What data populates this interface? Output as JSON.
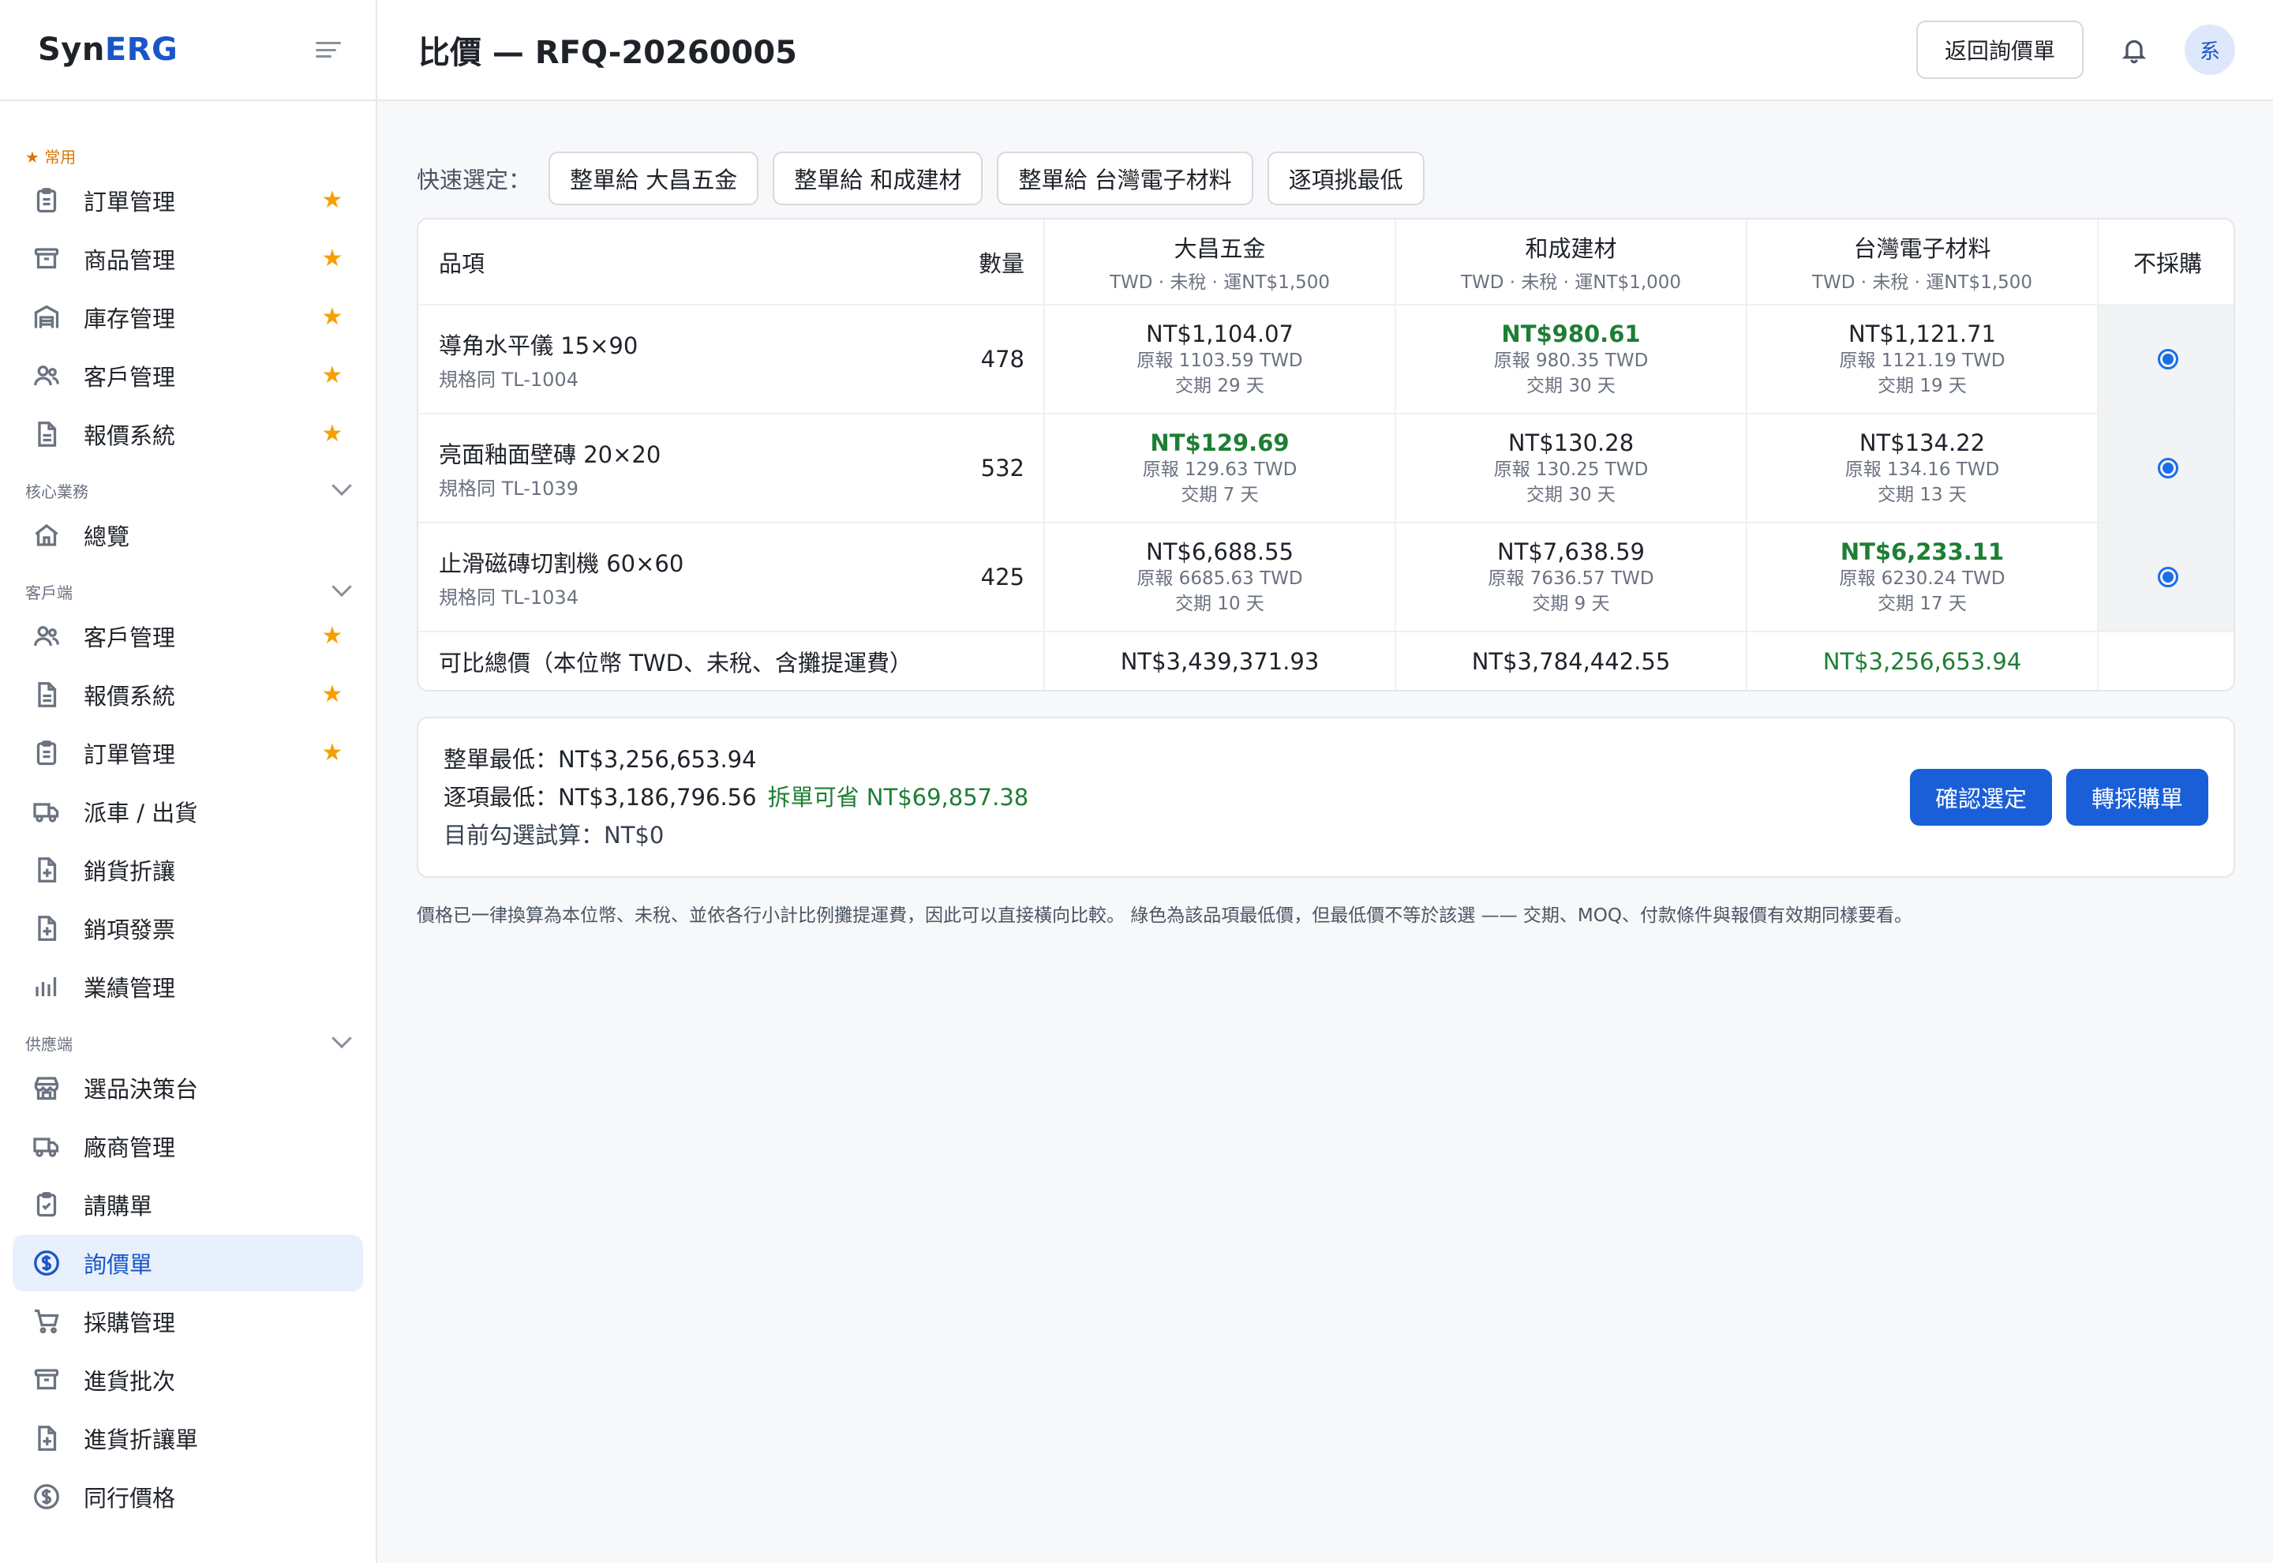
{
  "brand": {
    "syn": "Syn",
    "erg": "ERG"
  },
  "sidebar": {
    "favorites_label": "★ 常用",
    "favorites": [
      {
        "label": "訂單管理",
        "icon": "clipboard-icon"
      },
      {
        "label": "商品管理",
        "icon": "archive-icon"
      },
      {
        "label": "庫存管理",
        "icon": "warehouse-icon"
      },
      {
        "label": "客戶管理",
        "icon": "users-icon"
      },
      {
        "label": "報價系統",
        "icon": "document-icon"
      }
    ],
    "core_label": "核心業務",
    "core": [
      {
        "label": "總覽",
        "icon": "home-icon"
      }
    ],
    "client_label": "客戶端",
    "client": [
      {
        "label": "客戶管理",
        "icon": "users-icon",
        "starred": true
      },
      {
        "label": "報價系統",
        "icon": "document-icon",
        "starred": true
      },
      {
        "label": "訂單管理",
        "icon": "clipboard-icon",
        "starred": true
      },
      {
        "label": "派車 / 出貨",
        "icon": "truck-icon"
      },
      {
        "label": "銷貨折讓",
        "icon": "file-plus-icon"
      },
      {
        "label": "銷項發票",
        "icon": "file-plus-icon"
      },
      {
        "label": "業績管理",
        "icon": "bar-chart-icon"
      }
    ],
    "supplier_label": "供應端",
    "supplier": [
      {
        "label": "選品決策台",
        "icon": "store-icon"
      },
      {
        "label": "廠商管理",
        "icon": "truck-icon"
      },
      {
        "label": "請購單",
        "icon": "clipboard-check-icon"
      },
      {
        "label": "詢價單",
        "icon": "dollar-circle-icon",
        "active": true
      },
      {
        "label": "採購管理",
        "icon": "cart-icon"
      },
      {
        "label": "進貨批次",
        "icon": "archive-icon"
      },
      {
        "label": "進貨折讓單",
        "icon": "file-plus-icon"
      },
      {
        "label": "同行價格",
        "icon": "dollar-circle-icon"
      }
    ]
  },
  "header": {
    "title": "比價 — RFQ-20260005",
    "back_label": "返回詢價單",
    "avatar_text": "系"
  },
  "quick": {
    "label": "快速選定：",
    "options": [
      "整單給 大昌五金",
      "整單給 和成建材",
      "整單給 台灣電子材料",
      "逐項挑最低"
    ]
  },
  "table": {
    "col_item": "品項",
    "col_qty": "數量",
    "col_none": "不採購",
    "suppliers": [
      {
        "name": "大昌五金",
        "meta": "TWD · 未稅 · 運NT$1,500"
      },
      {
        "name": "和成建材",
        "meta": "TWD · 未稅 · 運NT$1,000"
      },
      {
        "name": "台灣電子材料",
        "meta": "TWD · 未稅 · 運NT$1,500"
      }
    ],
    "rows": [
      {
        "name": "導角水平儀 15×90",
        "spec": "規格同 TL-1004",
        "qty": "478",
        "quotes": [
          {
            "price": "NT$1,104.07",
            "orig": "原報 1103.59 TWD",
            "lead": "交期 29 天",
            "best": false
          },
          {
            "price": "NT$980.61",
            "orig": "原報 980.35 TWD",
            "lead": "交期 30 天",
            "best": true
          },
          {
            "price": "NT$1,121.71",
            "orig": "原報 1121.19 TWD",
            "lead": "交期 19 天",
            "best": false
          }
        ]
      },
      {
        "name": "亮面釉面壁磚 20×20",
        "spec": "規格同 TL-1039",
        "qty": "532",
        "quotes": [
          {
            "price": "NT$129.69",
            "orig": "原報 129.63 TWD",
            "lead": "交期 7 天",
            "best": true
          },
          {
            "price": "NT$130.28",
            "orig": "原報 130.25 TWD",
            "lead": "交期 30 天",
            "best": false
          },
          {
            "price": "NT$134.22",
            "orig": "原報 134.16 TWD",
            "lead": "交期 13 天",
            "best": false
          }
        ]
      },
      {
        "name": "止滑磁磚切割機 60×60",
        "spec": "規格同 TL-1034",
        "qty": "425",
        "quotes": [
          {
            "price": "NT$6,688.55",
            "orig": "原報 6685.63 TWD",
            "lead": "交期 10 天",
            "best": false
          },
          {
            "price": "NT$7,638.59",
            "orig": "原報 7636.57 TWD",
            "lead": "交期 9 天",
            "best": false
          },
          {
            "price": "NT$6,233.11",
            "orig": "原報 6230.24 TWD",
            "lead": "交期 17 天",
            "best": true
          }
        ]
      }
    ],
    "total_label": "可比總價（本位幣 TWD、未稅、含攤提運費）",
    "totals": [
      "NT$3,439,371.93",
      "NT$3,784,442.55",
      "NT$3,256,653.94"
    ]
  },
  "summary": {
    "whole_lowest": "整單最低：NT$3,256,653.94",
    "item_lowest": "逐項最低：NT$3,186,796.56",
    "split_saving": "拆單可省 NT$69,857.38",
    "current": "目前勾選試算：NT$0",
    "confirm_label": "確認選定",
    "to_po_label": "轉採購單"
  },
  "footnote": "價格已一律換算為本位幣、未稅、並依各行小計比例攤提運費，因此可以直接橫向比較。 綠色為該品項最低價，但最低價不等於該選 —— 交期、MOQ、付款條件與報價有效期同樣要看。",
  "colors": {
    "accent": "#1a5fd8",
    "best": "#1e7e34",
    "star": "#f5a000"
  }
}
